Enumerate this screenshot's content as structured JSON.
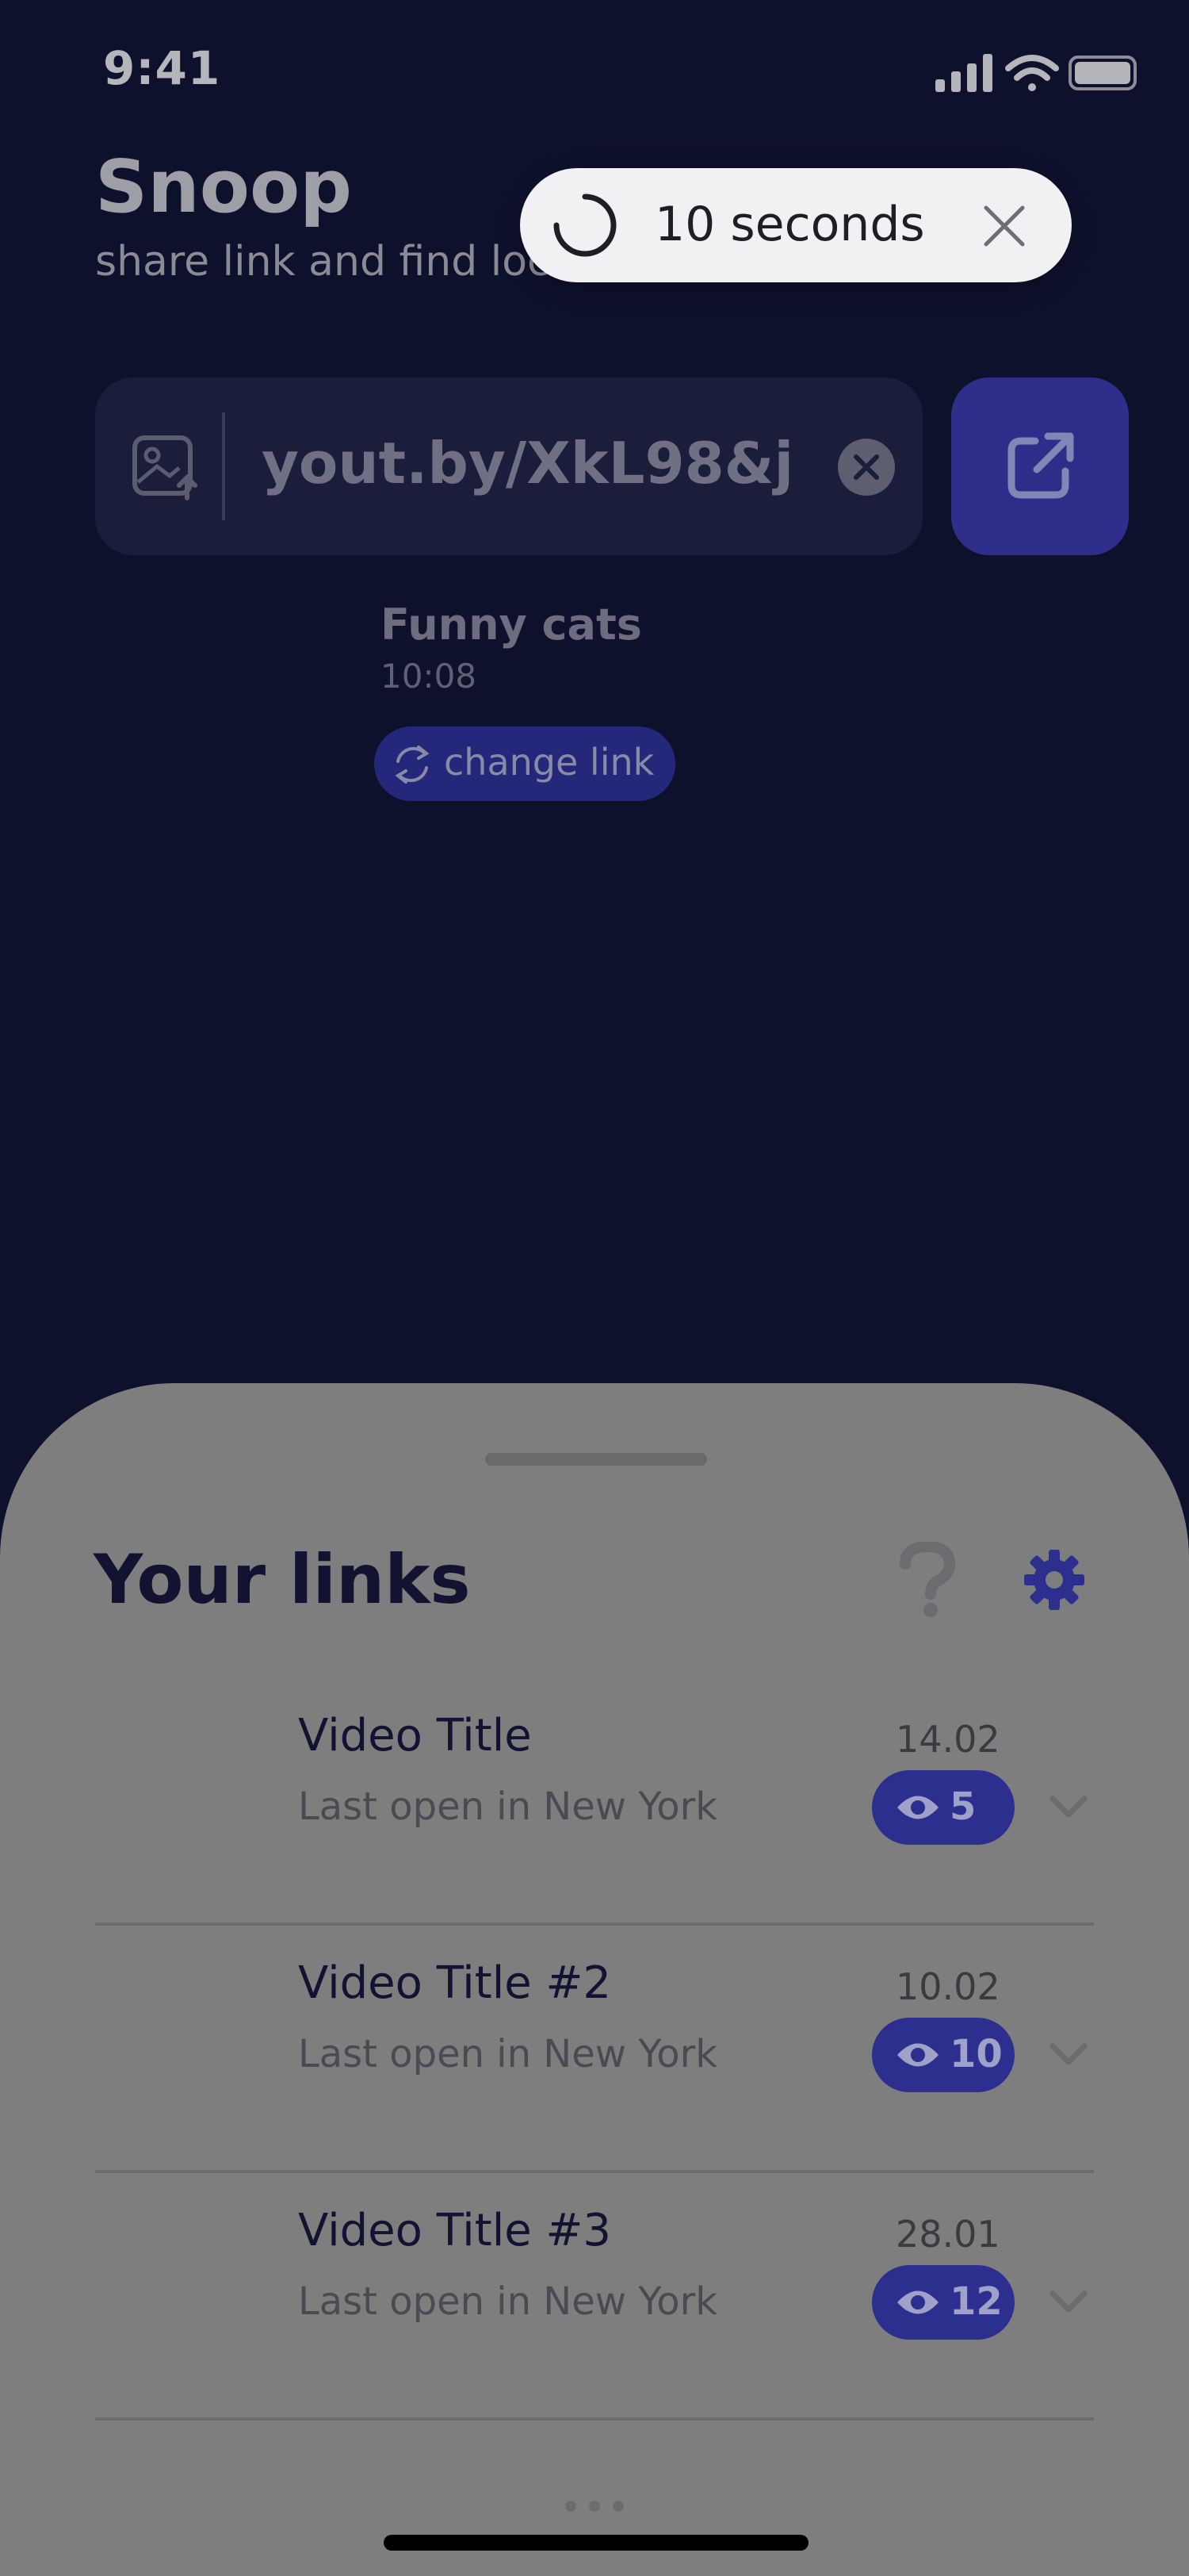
{
  "status_bar": {
    "time": "9:41"
  },
  "header": {
    "title": "Snoop",
    "subtitle": "share link and find location"
  },
  "toast": {
    "text": "10 seconds"
  },
  "url_field": {
    "value": "yout.by/XkL98&j"
  },
  "preview": {
    "title": "Funny cats",
    "time": "10:08",
    "change_label": "change link"
  },
  "sheet": {
    "title": "Your links",
    "items": [
      {
        "title": "Video Title",
        "subtitle": "Last open in New York",
        "date": "14.02",
        "views": "5"
      },
      {
        "title": "Video Title #2",
        "subtitle": "Last open in New York",
        "date": "10.02",
        "views": "10"
      },
      {
        "title": "Video Title #3",
        "subtitle": "Last open in New York",
        "date": "28.01",
        "views": "12"
      }
    ]
  },
  "colors": {
    "background": "#0e112c",
    "accent": "#2e2e8a",
    "sheet": "#7e7e7e"
  }
}
